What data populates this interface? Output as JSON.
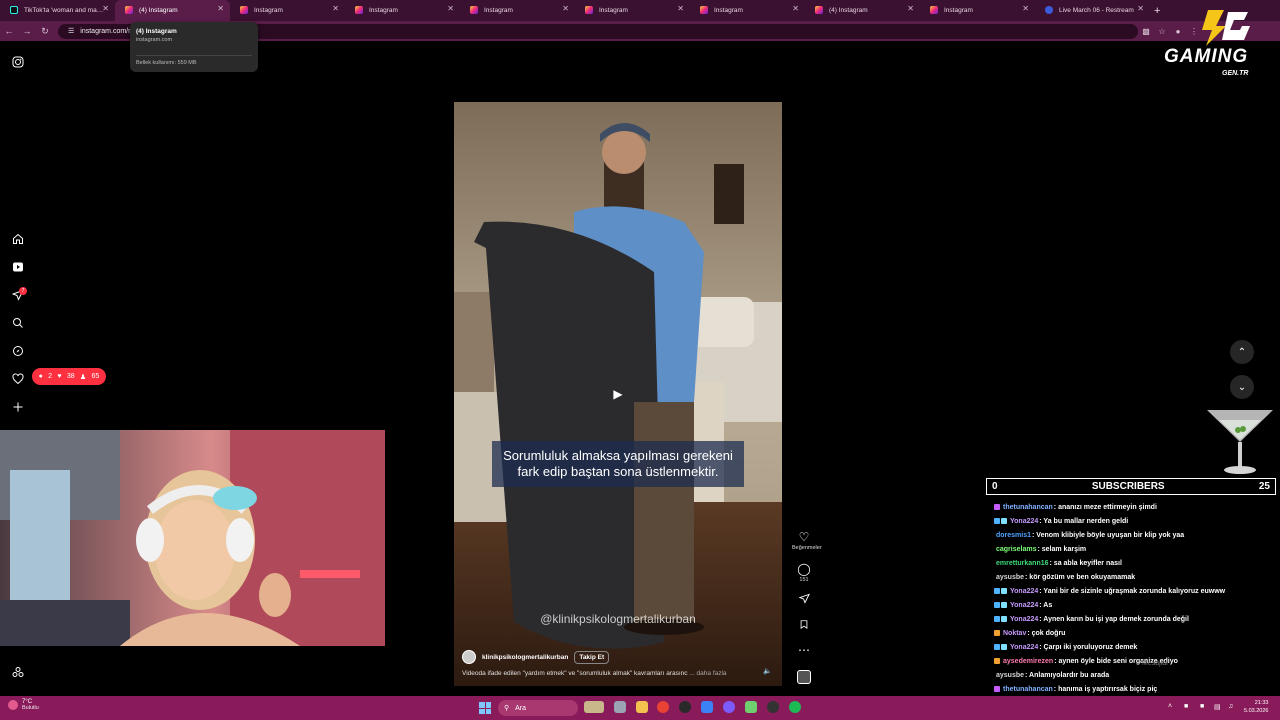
{
  "browser": {
    "tabs": [
      {
        "label": "TikTok'ta 'woman and man m",
        "icon": "tiktok-icon",
        "active": false
      },
      {
        "label": "(4) Instagram",
        "icon": "instagram-icon",
        "active": true
      },
      {
        "label": "Instagram",
        "icon": "instagram-icon",
        "active": false
      },
      {
        "label": "Instagram",
        "icon": "instagram-icon",
        "active": false
      },
      {
        "label": "Instagram",
        "icon": "instagram-icon",
        "active": false
      },
      {
        "label": "Instagram",
        "icon": "instagram-icon",
        "active": false
      },
      {
        "label": "Instagram",
        "icon": "instagram-icon",
        "active": false
      },
      {
        "label": "(4) Instagram",
        "icon": "instagram-icon",
        "active": false
      },
      {
        "label": "Instagram",
        "icon": "instagram-icon",
        "active": false
      },
      {
        "label": "Live March 06 - Restream",
        "icon": "restream-icon",
        "active": false
      }
    ],
    "url": "instagram.com/r",
    "tooltip": {
      "title": "(4) Instagram",
      "domain": "instagram.com",
      "memory": "Bellek kullanımı: 559 MB"
    }
  },
  "reel": {
    "caption": "Sorumluluk almaksa yapılması gerekeni fark edip baştan sona üstlenmektir.",
    "watermark": "@klinikpsikologmertalikurban",
    "author": "klinikpsikologmertalikurban",
    "follow_label": "Takip Et",
    "description": "Videoda ifade edilen \"yardım etmek\" ve \"sorumluluk almak\" kavramları arasınc",
    "more_label": "... daha fazla",
    "actions": {
      "like_label": "Beğenmeler",
      "comment_count": "151"
    }
  },
  "notifications": {
    "dot_count": "7",
    "comments": "2",
    "likes": "38",
    "follows": "65"
  },
  "logo": {
    "main": "GAMING",
    "sub": "GEN.TR"
  },
  "subscribers": {
    "left": "0",
    "title": "SUBSCRIBERS",
    "right": "25"
  },
  "chat": [
    {
      "name": "thetunahancan",
      "color": "#7fb0ff",
      "text": ": ananızı meze ettirmeyin şimdi",
      "badges": [
        "#c45cff"
      ]
    },
    {
      "name": "Yona224",
      "color": "#c79bff",
      "text": ": Ya bu mallar nerden geldi",
      "badges": [
        "#4fb3ff",
        "#7fe0ff"
      ]
    },
    {
      "name": "doresmis1",
      "color": "#4fa3ff",
      "text": ": Venom klibiyle böyle uyuşan bir klip yok yaa",
      "badges": []
    },
    {
      "name": "cagriselams",
      "color": "#7dff7a",
      "text": ": selam karşim",
      "badges": []
    },
    {
      "name": "emretturkann16",
      "color": "#3fd97a",
      "text": ": sa abla keyifler nasıl",
      "badges": []
    },
    {
      "name": "aysusbe",
      "color": "#d8d8d8",
      "text": ": kör gözüm ve ben okuyamamak",
      "badges": []
    },
    {
      "name": "Yona224",
      "color": "#c79bff",
      "text": ": Yani bir de sizinle uğraşmak zorunda kalıyoruz euwww",
      "badges": [
        "#4fb3ff",
        "#7fe0ff"
      ]
    },
    {
      "name": "Yona224",
      "color": "#c79bff",
      "text": ": As",
      "badges": [
        "#4fb3ff",
        "#7fe0ff"
      ]
    },
    {
      "name": "Yona224",
      "color": "#c79bff",
      "text": ": Aynen karın bu işi yap demek zorunda değil",
      "badges": [
        "#4fb3ff",
        "#7fe0ff"
      ]
    },
    {
      "name": "Noktav",
      "color": "#c79bff",
      "text": ": çok doğru",
      "badges": [
        "#f0a030"
      ]
    },
    {
      "name": "Yona224",
      "color": "#c79bff",
      "text": ": Çarpı iki yoruluyoruz demek",
      "badges": [
        "#4fb3ff",
        "#7fe0ff"
      ]
    },
    {
      "name": "aysedemirezen",
      "color": "#ff7ab0",
      "text": ": aynen öyle bide seni organize ediyo",
      "badges": [
        "#f0a030"
      ]
    },
    {
      "name": "aysusbe",
      "color": "#d8d8d8",
      "text": ": Anlamıyolardır bu arada",
      "badges": []
    },
    {
      "name": "thetunahancan",
      "color": "#7fb0ff",
      "text": ": hanıma iş yaptırırsak biçiz piç",
      "badges": [
        "#c45cff"
      ]
    }
  ],
  "chat_overlay": "Mesajlar",
  "taskbar": {
    "weather_temp": "7°C",
    "weather_desc": "Bulutlu",
    "search_placeholder": "Ara",
    "time": "21:33",
    "date": "5.03.2026"
  }
}
